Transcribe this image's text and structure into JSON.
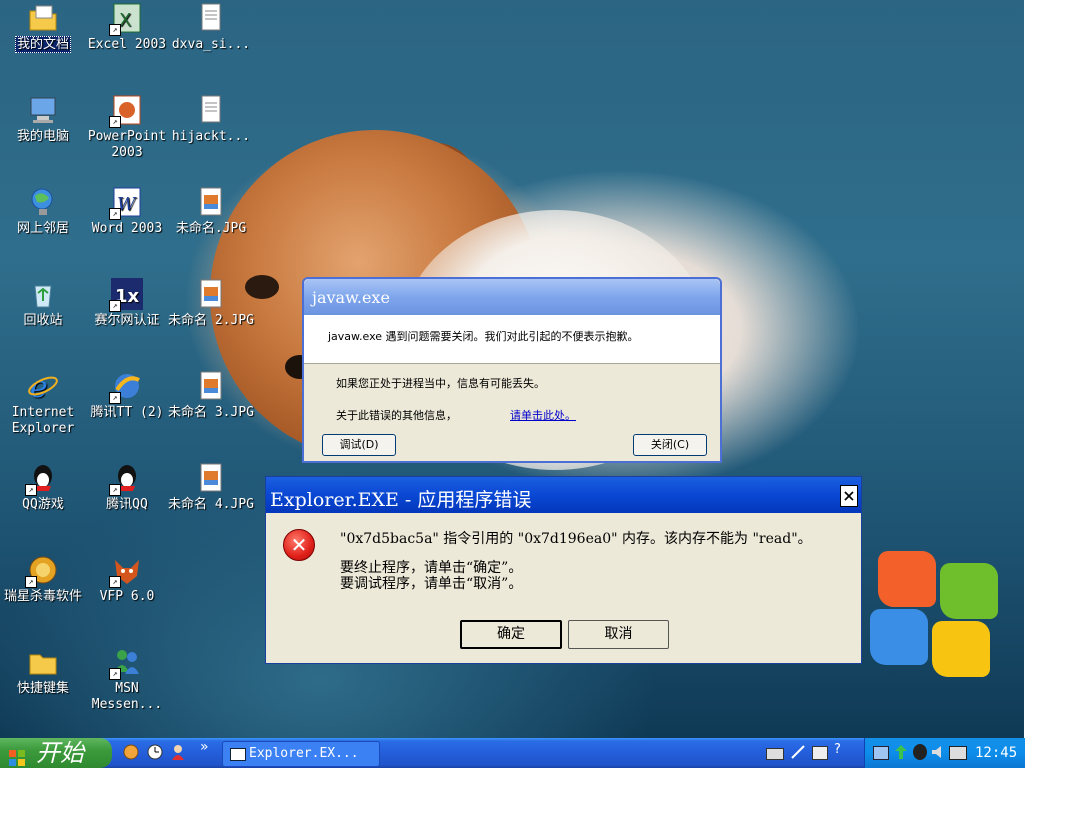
{
  "desktop_icons": [
    {
      "label": "我的文档",
      "icon": "my-documents-icon"
    },
    {
      "label": "Excel 2003",
      "icon": "excel-icon"
    },
    {
      "label": "dxva_si...",
      "icon": "text-file-icon"
    },
    {
      "label": "我的电脑",
      "icon": "my-computer-icon"
    },
    {
      "label": "PowerPoint 2003",
      "icon": "powerpoint-icon"
    },
    {
      "label": "hijackt...",
      "icon": "text-file-icon"
    },
    {
      "label": "网上邻居",
      "icon": "network-icon"
    },
    {
      "label": "Word 2003",
      "icon": "word-icon"
    },
    {
      "label": "未命名.JPG",
      "icon": "image-file-icon"
    },
    {
      "label": "回收站",
      "icon": "recycle-bin-icon"
    },
    {
      "label": "赛尔网认证",
      "icon": "auth-app-icon"
    },
    {
      "label": "未命名 2.JPG",
      "icon": "image-file-icon"
    },
    {
      "label": "Internet Explorer",
      "icon": "internet-explorer-icon"
    },
    {
      "label": "腾讯TT (2)",
      "icon": "tencent-tt-icon"
    },
    {
      "label": "未命名 3.JPG",
      "icon": "image-file-icon"
    },
    {
      "label": "QQ游戏",
      "icon": "qq-game-icon"
    },
    {
      "label": "腾讯QQ",
      "icon": "qq-icon"
    },
    {
      "label": "未命名 4.JPG",
      "icon": "image-file-icon"
    },
    {
      "label": "瑞星杀毒软件",
      "icon": "rising-antivirus-icon"
    },
    {
      "label": "VFP 6.0",
      "icon": "vfp-icon"
    },
    {
      "label": "快捷键集",
      "icon": "folder-icon"
    },
    {
      "label": "MSN Messen...",
      "icon": "msn-icon"
    }
  ],
  "javaw_dialog": {
    "title": "javaw.exe",
    "message": "javaw.exe 遇到问题需要关闭。我们对此引起的不便表示抱歉。",
    "info_lost": "如果您正处于进程当中，信息有可能丢失。",
    "more_info": "关于此错误的其他信息，",
    "more_info_link": "请单击此处。",
    "debug_button": "调试(D)",
    "close_button": "关闭(C)"
  },
  "explorer_dialog": {
    "title": "Explorer.EXE - 应用程序错误",
    "close_glyph": "×",
    "error_line": "\"0x7d5bac5a\" 指令引用的 \"0x7d196ea0\" 内存。该内存不能为 \"read\"。",
    "terminate_hint": "要终止程序，请单击“确定”。",
    "debug_hint": "要调试程序，请单击“取消”。",
    "ok_button": "确定",
    "cancel_button": "取消",
    "error_icon_glyph": "✕"
  },
  "taskbar": {
    "start_label": "开始",
    "quicklaunch_chevron": "»",
    "task_button": "Explorer.EX...",
    "clock": "12:45"
  }
}
